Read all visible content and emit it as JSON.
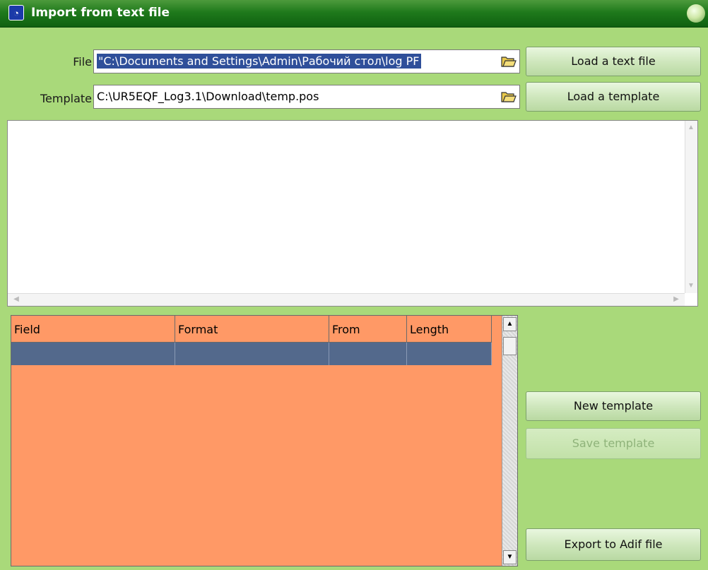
{
  "window": {
    "title": "Import from text file",
    "icon": "app-icon"
  },
  "file": {
    "label": "File",
    "value": "\"C:\\Documents and Settings\\Admin\\Рабочий стол\\log PF"
  },
  "template": {
    "label": "Template",
    "value": "C:\\UR5EQF_Log3.1\\Download\\temp.pos"
  },
  "buttons": {
    "load_text_file": "Load a text file",
    "load_template": "Load a template",
    "new_template": "New template",
    "save_template": "Save template",
    "export_adif": "Export to Adif file"
  },
  "grid": {
    "columns": [
      "Field",
      "Format",
      "From",
      "Length"
    ],
    "rows": [
      [
        "",
        "",
        "",
        ""
      ]
    ]
  },
  "colors": {
    "background": "#a9d97a",
    "titlebar": "#1f7a1c",
    "grid": "#ff9966",
    "selected_row": "#53698c"
  }
}
